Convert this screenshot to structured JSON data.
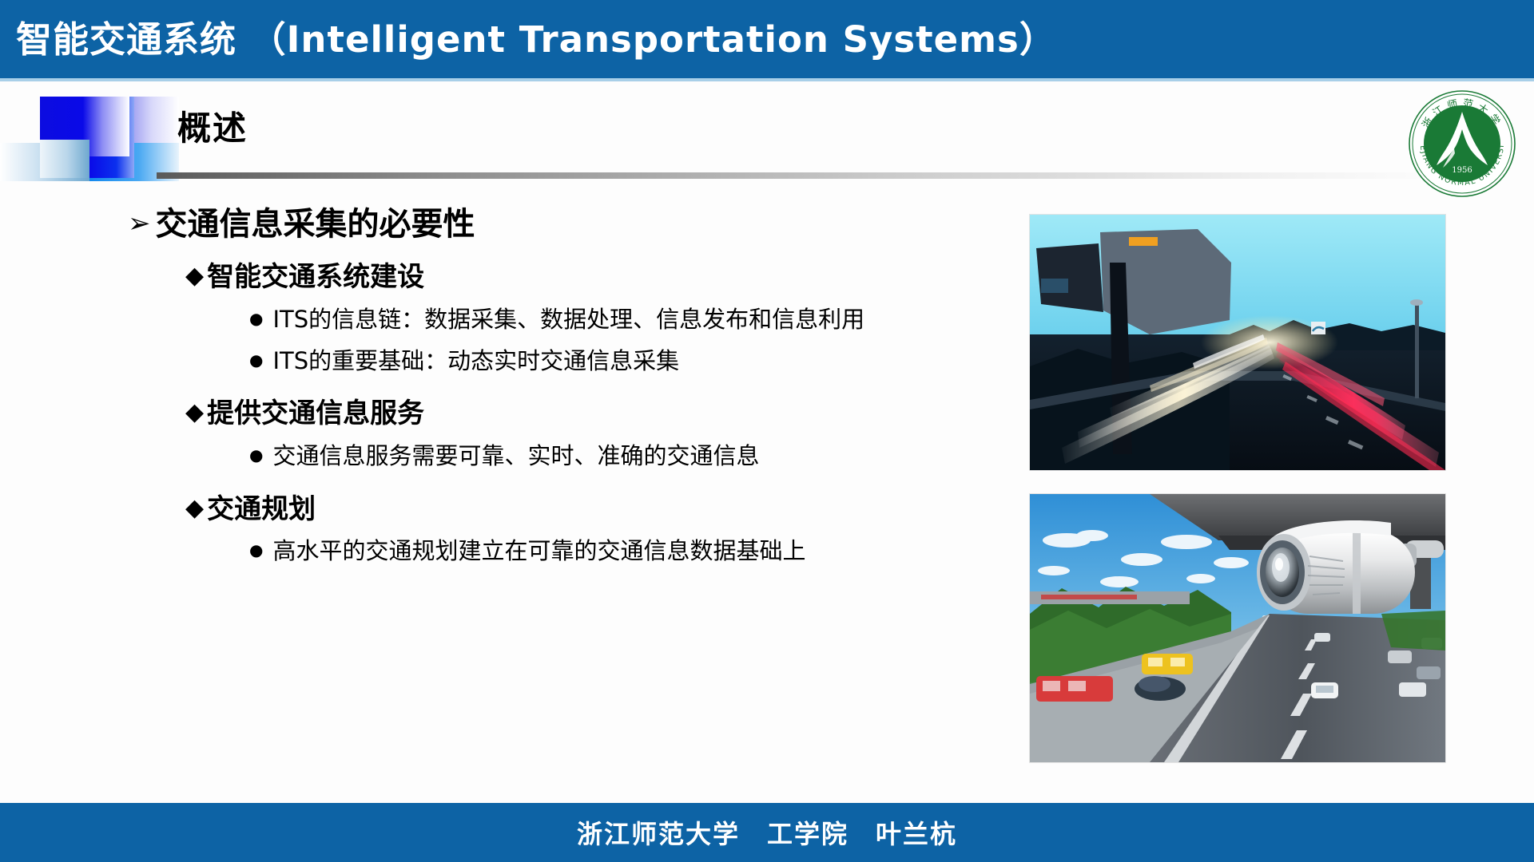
{
  "header": {
    "title": "智能交通系统 （Intelligent Transportation Systems）"
  },
  "slide": {
    "title": "概述"
  },
  "logo": {
    "name_cn": "浙江师范大学",
    "name_en_top": "ZHEJIANG",
    "name_en_bottom": "NORMAL UNIVERSITY",
    "year": "1956",
    "color": "#1a7a36"
  },
  "content": {
    "level1": "交通信息采集的必要性",
    "level1_bullet": "➢",
    "level2_bullet": "◆",
    "level3_bullet": "●",
    "sections": [
      {
        "heading": "智能交通系统建设",
        "items": [
          "ITS的信息链：数据采集、数据处理、信息发布和信息利用",
          "ITS的重要基础：动态实时交通信息采集"
        ]
      },
      {
        "heading": "提供交通信息服务",
        "items": [
          "交通信息服务需要可靠、实时、准确的交通信息"
        ]
      },
      {
        "heading": "交通规划",
        "items": [
          "高水平的交通规划建立在可靠的交通信息数据基础上"
        ]
      }
    ]
  },
  "images": [
    {
      "name": "highway-night-light-trails",
      "alt": "夜间高速公路车流光轨"
    },
    {
      "name": "cctv-traffic-camera",
      "alt": "高速公路监控摄像头"
    }
  ],
  "footer": {
    "text": "浙江师范大学　工学院　叶兰杭"
  },
  "theme": {
    "bar_blue": "#0d63a5",
    "bar_blue_light": "#a8cfe8",
    "deco_blue": "#0a0ae8",
    "text_black": "#000000"
  }
}
